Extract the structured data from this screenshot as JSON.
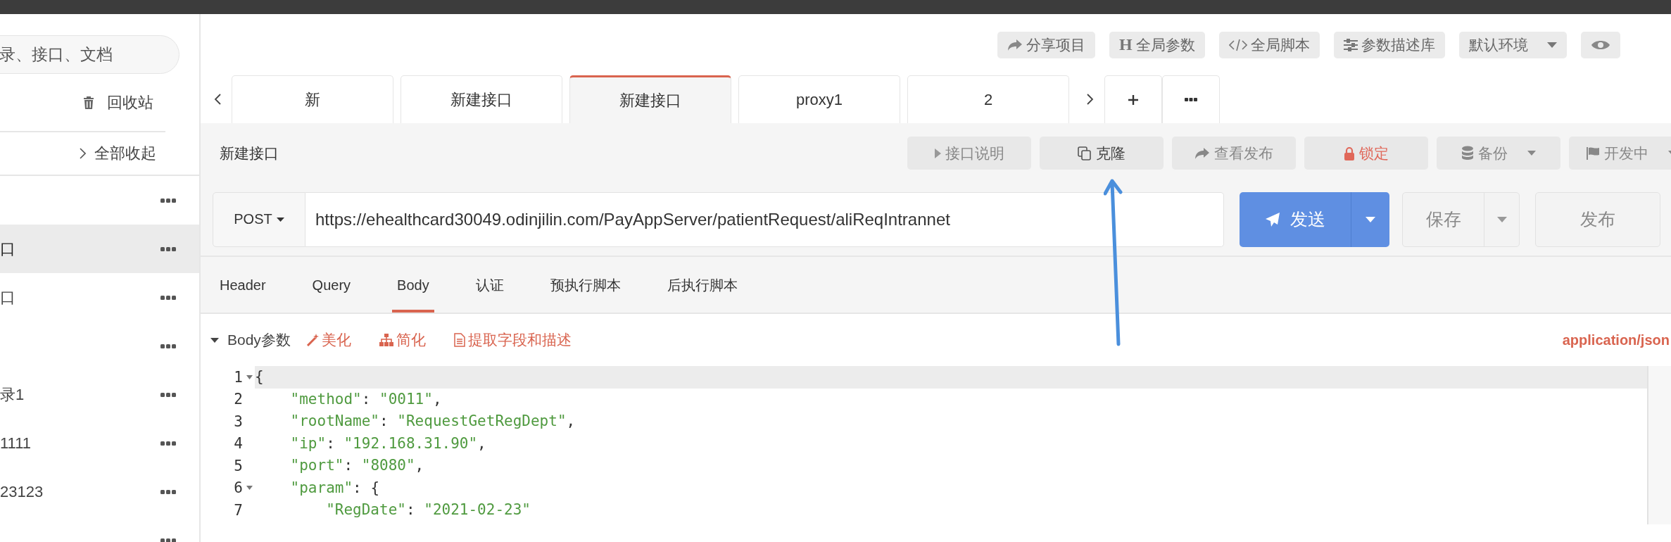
{
  "sidebar": {
    "search": {
      "placeholder": "录、接口、文档"
    },
    "recycle_bin": "回收站",
    "collapse_all": "全部收起",
    "items": [
      {
        "selected": false
      },
      {
        "label": "口",
        "selected": true
      },
      {
        "label": "口",
        "selected": false
      },
      {
        "selected": false
      },
      {
        "label": "录1",
        "selected": false
      },
      {
        "label": "1111",
        "selected": false
      },
      {
        "label": "23123",
        "selected": false
      },
      {
        "selected": false
      }
    ]
  },
  "toolbar": {
    "buttons": [
      {
        "kind": "share",
        "label": "分享项目"
      },
      {
        "kind": "global-params",
        "icon_text": "H",
        "label": "全局参数"
      },
      {
        "kind": "global-script",
        "label": "全局脚本"
      },
      {
        "kind": "param-library",
        "label": "参数描述库"
      },
      {
        "kind": "environment",
        "label": "默认环境"
      },
      {
        "kind": "eye"
      }
    ]
  },
  "tabs": [
    {
      "label": "新",
      "selected": false
    },
    {
      "label": "新建接口",
      "selected": false
    },
    {
      "label": "新建接口",
      "selected": true
    },
    {
      "label": "proxy1",
      "selected": false
    },
    {
      "label": "2",
      "selected": false
    }
  ],
  "request": {
    "title": "新建接口",
    "actions": [
      {
        "kind": "info",
        "label": "接口说明"
      },
      {
        "kind": "clone",
        "label": "克隆"
      },
      {
        "kind": "view-publish",
        "label": "查看发布"
      },
      {
        "kind": "lock",
        "label": "锁定"
      },
      {
        "kind": "backup",
        "label": "备份"
      },
      {
        "kind": "status",
        "label": "开发中"
      }
    ],
    "method": "POST",
    "url": "https://ehealthcard30049.odinjilin.com/PayAppServer/patientRequest/aliReqIntrannet",
    "send": "发送",
    "save": "保存",
    "publish": "发布"
  },
  "sub_tabs": [
    {
      "label": "Header",
      "selected": false
    },
    {
      "label": "Query",
      "selected": false
    },
    {
      "label": "Body",
      "selected": true
    },
    {
      "label": "认证",
      "selected": false
    },
    {
      "label": "预执行脚本",
      "selected": false
    },
    {
      "label": "后执行脚本",
      "selected": false
    }
  ],
  "body": {
    "title": "Body参数",
    "tools": [
      {
        "kind": "beautify",
        "label": "美化"
      },
      {
        "kind": "simplify",
        "label": "简化"
      },
      {
        "kind": "extract",
        "label": "提取字段和描述"
      }
    ],
    "content_type": "application/json",
    "lines": [
      {
        "number": "1",
        "text": "{",
        "foldable": true,
        "active": true
      },
      {
        "number": "2",
        "text": "    \"method\": \"0011\",",
        "foldable": false,
        "active": false
      },
      {
        "number": "3",
        "text": "    \"rootName\": \"RequestGetRegDept\",",
        "foldable": false,
        "active": false
      },
      {
        "number": "4",
        "text": "    \"ip\": \"192.168.31.90\",",
        "foldable": false,
        "active": false
      },
      {
        "number": "5",
        "text": "    \"port\": \"8080\",",
        "foldable": false,
        "active": false
      },
      {
        "number": "6",
        "text": "    \"param\": {",
        "foldable": true,
        "active": false
      },
      {
        "number": "7",
        "text": "        \"RegDate\": \"2021-02-23\"",
        "foldable": false,
        "active": false
      }
    ]
  }
}
